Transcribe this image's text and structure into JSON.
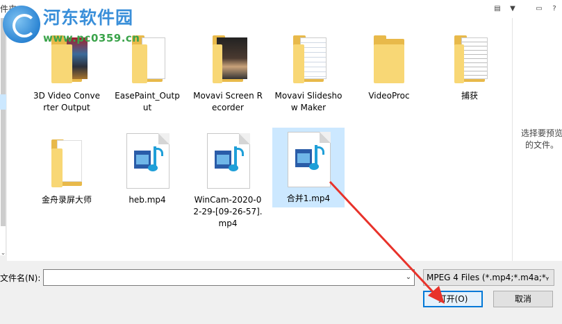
{
  "header": {
    "breadcrumb_fragment": "件夹",
    "view_menu_icon": "view-menu-icon",
    "dropdown_icon": "chevron-down-icon",
    "pane_icon": "preview-pane-icon",
    "help_icon": "help-icon"
  },
  "watermark": {
    "site_name": "河东软件园",
    "url": "www.pc0359.cn"
  },
  "files": [
    {
      "name": "3D Video Converter Output",
      "kind": "folder"
    },
    {
      "name": "EasePaint_Output",
      "kind": "folder"
    },
    {
      "name": "Movavi Screen Recorder",
      "kind": "folder"
    },
    {
      "name": "Movavi Slideshow Maker",
      "kind": "folder"
    },
    {
      "name": "VideoProc",
      "kind": "folder"
    },
    {
      "name": "捕获",
      "kind": "folder"
    },
    {
      "name": "金舟录屏大师",
      "kind": "folder"
    },
    {
      "name": "heb.mp4",
      "kind": "video"
    },
    {
      "name": "WinCam-2020-02-29-[09-26-57].mp4",
      "kind": "video"
    },
    {
      "name": "合并1.mp4",
      "kind": "video",
      "selected": true
    }
  ],
  "preview": {
    "message": "选择要预览的文件。"
  },
  "footer": {
    "filename_label": "文件名(N):",
    "filename_value": "",
    "filetype_value": "MPEG 4 Files (*.mp4;*.m4a;*.",
    "open_label": "打开(O)",
    "cancel_label": "取消"
  },
  "colors": {
    "selection": "#cce8ff",
    "primary_border": "#0078d7",
    "annotation_arrow": "#e8322a"
  }
}
